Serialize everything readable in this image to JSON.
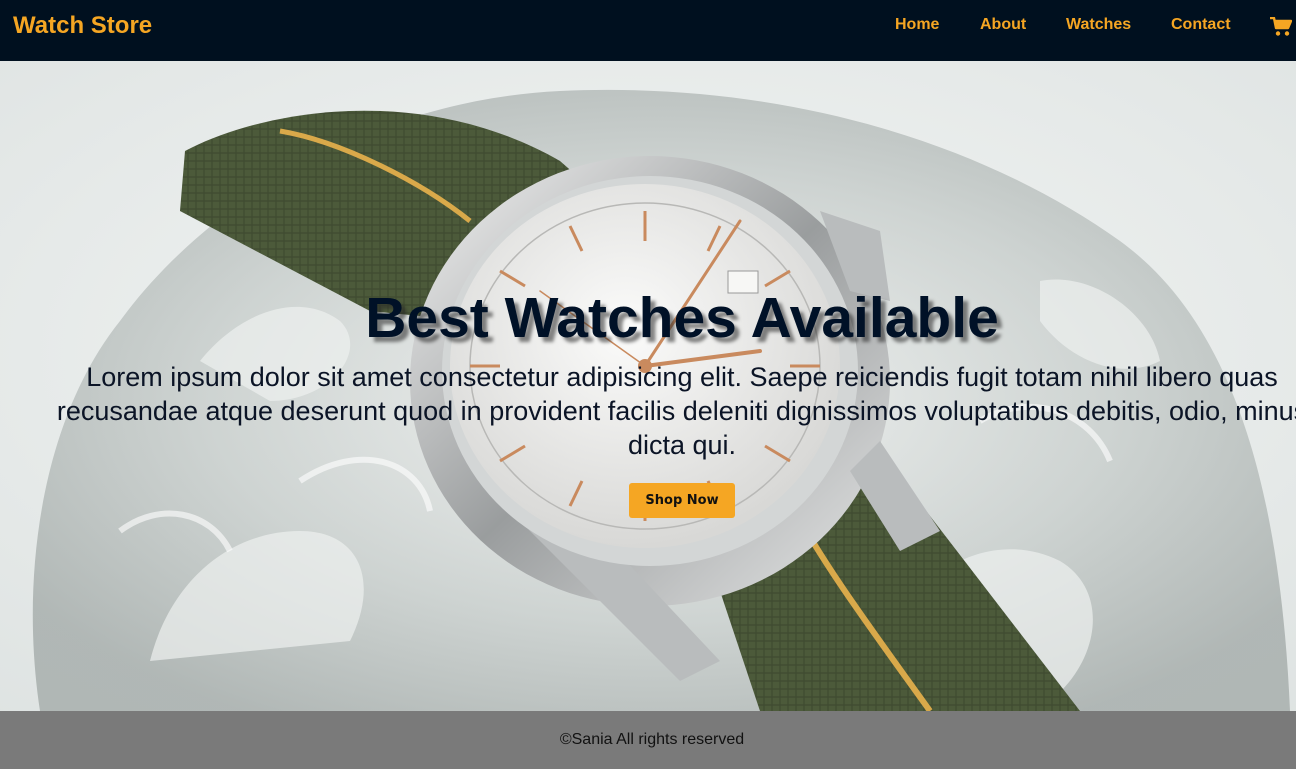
{
  "navbar": {
    "brand": "Watch Store",
    "links": [
      {
        "label": "Home"
      },
      {
        "label": "About"
      },
      {
        "label": "Watches"
      },
      {
        "label": "Contact"
      }
    ],
    "cart_icon": "shopping-cart-icon"
  },
  "hero": {
    "title": "Best Watches Available",
    "text": "Lorem ipsum dolor sit amet consectetur adipisicing elit. Saepe reiciendis fugit totam nihil libero quas recusandae atque deserunt quod in provident facilis deleniti dignissimos voluptatibus debitis, odio, minus dicta qui.",
    "button_label": "Shop Now",
    "image": "wristwatch-on-glass-photo"
  },
  "footer": {
    "text": "©Sania All rights reserved"
  },
  "colors": {
    "navbar_bg": "#00101f",
    "accent": "#f5a623",
    "footer_bg": "#7a7a7a",
    "title_color": "#001127"
  }
}
